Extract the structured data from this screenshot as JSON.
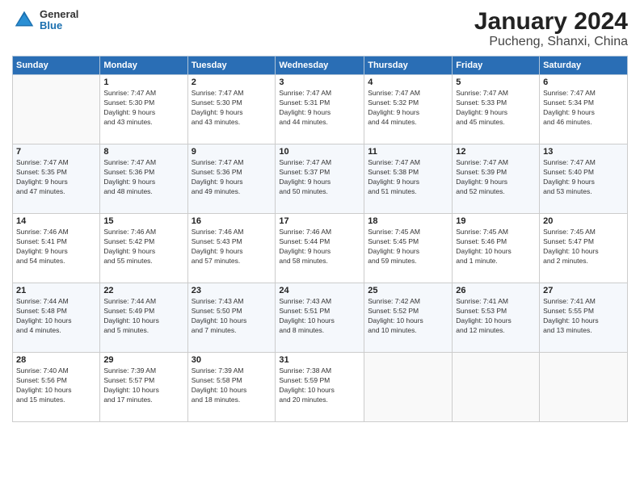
{
  "logo": {
    "general": "General",
    "blue": "Blue"
  },
  "title": "January 2024",
  "subtitle": "Pucheng, Shanxi, China",
  "days_of_week": [
    "Sunday",
    "Monday",
    "Tuesday",
    "Wednesday",
    "Thursday",
    "Friday",
    "Saturday"
  ],
  "weeks": [
    [
      {
        "day": "",
        "info": ""
      },
      {
        "day": "1",
        "info": "Sunrise: 7:47 AM\nSunset: 5:30 PM\nDaylight: 9 hours\nand 43 minutes."
      },
      {
        "day": "2",
        "info": "Sunrise: 7:47 AM\nSunset: 5:30 PM\nDaylight: 9 hours\nand 43 minutes."
      },
      {
        "day": "3",
        "info": "Sunrise: 7:47 AM\nSunset: 5:31 PM\nDaylight: 9 hours\nand 44 minutes."
      },
      {
        "day": "4",
        "info": "Sunrise: 7:47 AM\nSunset: 5:32 PM\nDaylight: 9 hours\nand 44 minutes."
      },
      {
        "day": "5",
        "info": "Sunrise: 7:47 AM\nSunset: 5:33 PM\nDaylight: 9 hours\nand 45 minutes."
      },
      {
        "day": "6",
        "info": "Sunrise: 7:47 AM\nSunset: 5:34 PM\nDaylight: 9 hours\nand 46 minutes."
      }
    ],
    [
      {
        "day": "7",
        "info": "Sunrise: 7:47 AM\nSunset: 5:35 PM\nDaylight: 9 hours\nand 47 minutes."
      },
      {
        "day": "8",
        "info": "Sunrise: 7:47 AM\nSunset: 5:36 PM\nDaylight: 9 hours\nand 48 minutes."
      },
      {
        "day": "9",
        "info": "Sunrise: 7:47 AM\nSunset: 5:36 PM\nDaylight: 9 hours\nand 49 minutes."
      },
      {
        "day": "10",
        "info": "Sunrise: 7:47 AM\nSunset: 5:37 PM\nDaylight: 9 hours\nand 50 minutes."
      },
      {
        "day": "11",
        "info": "Sunrise: 7:47 AM\nSunset: 5:38 PM\nDaylight: 9 hours\nand 51 minutes."
      },
      {
        "day": "12",
        "info": "Sunrise: 7:47 AM\nSunset: 5:39 PM\nDaylight: 9 hours\nand 52 minutes."
      },
      {
        "day": "13",
        "info": "Sunrise: 7:47 AM\nSunset: 5:40 PM\nDaylight: 9 hours\nand 53 minutes."
      }
    ],
    [
      {
        "day": "14",
        "info": "Sunrise: 7:46 AM\nSunset: 5:41 PM\nDaylight: 9 hours\nand 54 minutes."
      },
      {
        "day": "15",
        "info": "Sunrise: 7:46 AM\nSunset: 5:42 PM\nDaylight: 9 hours\nand 55 minutes."
      },
      {
        "day": "16",
        "info": "Sunrise: 7:46 AM\nSunset: 5:43 PM\nDaylight: 9 hours\nand 57 minutes."
      },
      {
        "day": "17",
        "info": "Sunrise: 7:46 AM\nSunset: 5:44 PM\nDaylight: 9 hours\nand 58 minutes."
      },
      {
        "day": "18",
        "info": "Sunrise: 7:45 AM\nSunset: 5:45 PM\nDaylight: 9 hours\nand 59 minutes."
      },
      {
        "day": "19",
        "info": "Sunrise: 7:45 AM\nSunset: 5:46 PM\nDaylight: 10 hours\nand 1 minute."
      },
      {
        "day": "20",
        "info": "Sunrise: 7:45 AM\nSunset: 5:47 PM\nDaylight: 10 hours\nand 2 minutes."
      }
    ],
    [
      {
        "day": "21",
        "info": "Sunrise: 7:44 AM\nSunset: 5:48 PM\nDaylight: 10 hours\nand 4 minutes."
      },
      {
        "day": "22",
        "info": "Sunrise: 7:44 AM\nSunset: 5:49 PM\nDaylight: 10 hours\nand 5 minutes."
      },
      {
        "day": "23",
        "info": "Sunrise: 7:43 AM\nSunset: 5:50 PM\nDaylight: 10 hours\nand 7 minutes."
      },
      {
        "day": "24",
        "info": "Sunrise: 7:43 AM\nSunset: 5:51 PM\nDaylight: 10 hours\nand 8 minutes."
      },
      {
        "day": "25",
        "info": "Sunrise: 7:42 AM\nSunset: 5:52 PM\nDaylight: 10 hours\nand 10 minutes."
      },
      {
        "day": "26",
        "info": "Sunrise: 7:41 AM\nSunset: 5:53 PM\nDaylight: 10 hours\nand 12 minutes."
      },
      {
        "day": "27",
        "info": "Sunrise: 7:41 AM\nSunset: 5:55 PM\nDaylight: 10 hours\nand 13 minutes."
      }
    ],
    [
      {
        "day": "28",
        "info": "Sunrise: 7:40 AM\nSunset: 5:56 PM\nDaylight: 10 hours\nand 15 minutes."
      },
      {
        "day": "29",
        "info": "Sunrise: 7:39 AM\nSunset: 5:57 PM\nDaylight: 10 hours\nand 17 minutes."
      },
      {
        "day": "30",
        "info": "Sunrise: 7:39 AM\nSunset: 5:58 PM\nDaylight: 10 hours\nand 18 minutes."
      },
      {
        "day": "31",
        "info": "Sunrise: 7:38 AM\nSunset: 5:59 PM\nDaylight: 10 hours\nand 20 minutes."
      },
      {
        "day": "",
        "info": ""
      },
      {
        "day": "",
        "info": ""
      },
      {
        "day": "",
        "info": ""
      }
    ]
  ]
}
